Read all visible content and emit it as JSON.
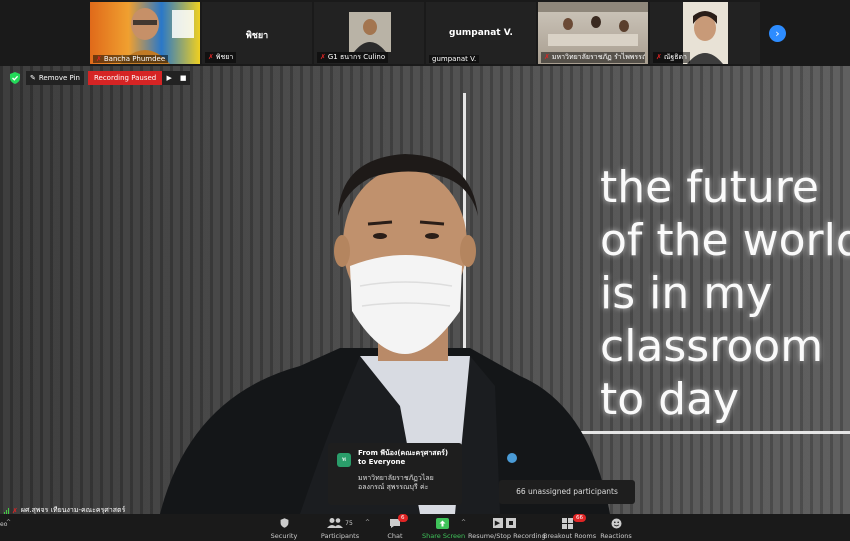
{
  "strip": {
    "tiles": [
      {
        "name": "Bancha Phumdee",
        "center": ""
      },
      {
        "name": "พิชยา",
        "center": "พิชยา"
      },
      {
        "name": "G1 ธนากร Culino",
        "center": ""
      },
      {
        "name": "gumpanat V.",
        "center": "gumpanat V."
      },
      {
        "name": "มหาวิทยาลัยราชภัฏ รำไพพรรณี",
        "center": ""
      },
      {
        "name": "ณัฐธิดา",
        "center": ""
      }
    ],
    "next_icon": "chevron-right-icon"
  },
  "main": {
    "wall_text": [
      "the future",
      "of the world",
      "is in my",
      "classroom",
      "to day"
    ],
    "remove_pin_label": "Remove Pin",
    "recording_label": "Recording Paused",
    "speaker_name": "ผศ.สุพจร เทียนงาม-คณะครุศาสตร์",
    "chat": {
      "avatar": "พ",
      "from": "From พีน้อง(คณะครุศาสตร์) to Everyone",
      "message": "มหาวิทยาลัยราชภัฏวไลยอลงกรณ์ สุพรรณบุรี ค่ะ"
    },
    "unassigned": "66 unassigned participants"
  },
  "toolbar": {
    "security": "Security",
    "participants": "Participants",
    "participants_count": "75",
    "chat": "Chat",
    "chat_badge": "6",
    "share": "Share Screen",
    "recording": "Resume/Stop Recording",
    "breakout": "Breakout Rooms",
    "breakout_badge": "66",
    "reactions": "Reactions",
    "left_edge": "eo"
  },
  "colors": {
    "accent": "#2d8cff",
    "record_red": "#d62424",
    "share_green": "#3fc35a"
  }
}
